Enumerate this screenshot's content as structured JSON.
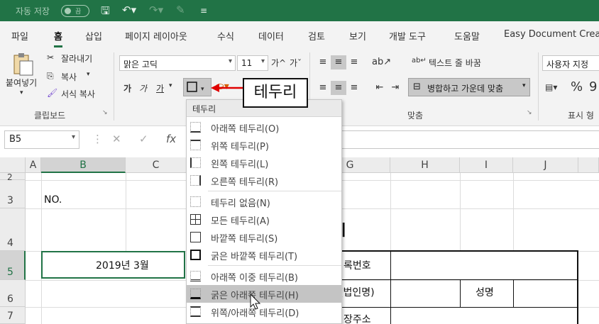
{
  "titlebar": {
    "autosave_label": "자동 저장",
    "toggle_state": "끔"
  },
  "menu": [
    "파일",
    "홈",
    "삽입",
    "페이지 레이아웃",
    "수식",
    "데이터",
    "검토",
    "보기",
    "개발 도구",
    "도움말",
    "Easy Document Crea"
  ],
  "clipboard": {
    "paste": "붙여넣기",
    "cut": "잘라내기",
    "copy": "복사",
    "format_painter": "서식 복사",
    "group": "클립보드"
  },
  "font": {
    "name": "맑은 고딕",
    "size": "11",
    "grow": "가^",
    "shrink": "가ˇ",
    "bold": "가",
    "italic": "가",
    "underline": "가"
  },
  "alignment": {
    "wrap": "텍스트 줄 바꿈",
    "merge": "병합하고 가운데 맞춤",
    "group": "맞춤"
  },
  "number": {
    "format": "사용자 지정",
    "percent": "%",
    "comma": "9",
    "group": "표시 형"
  },
  "callout": "테두리",
  "formula": {
    "namebox": "B5",
    "cancel": "✕",
    "enter": "✓",
    "fx": "fx"
  },
  "columns": [
    "A",
    "B",
    "C",
    "G",
    "H",
    "I",
    "J"
  ],
  "rows": [
    "2",
    "3",
    "4",
    "5",
    "6",
    "7"
  ],
  "cells": {
    "b3": "NO.",
    "b5": "2019년     3월",
    "g5": "록번호",
    "g6": "(법인명)",
    "i6": "성명",
    "g7": "장주소",
    "title_fragment": "I"
  },
  "dropdown": {
    "header": "테두리",
    "items": [
      "아래쪽 테두리(O)",
      "위쪽 테두리(P)",
      "왼쪽 테두리(L)",
      "오른쪽 테두리(R)",
      "테두리 없음(N)",
      "모든 테두리(A)",
      "바깥쪽 테두리(S)",
      "굵은 바깥쪽 테두리(T)",
      "아래쪽 이중 테두리(B)",
      "굵은 아래쪽 테두리(H)",
      "위쪽/아래쪽 테두리(D)"
    ],
    "hover_index": 9
  },
  "colors": {
    "accent": "#217346",
    "callout_arrow": "#e00000"
  }
}
